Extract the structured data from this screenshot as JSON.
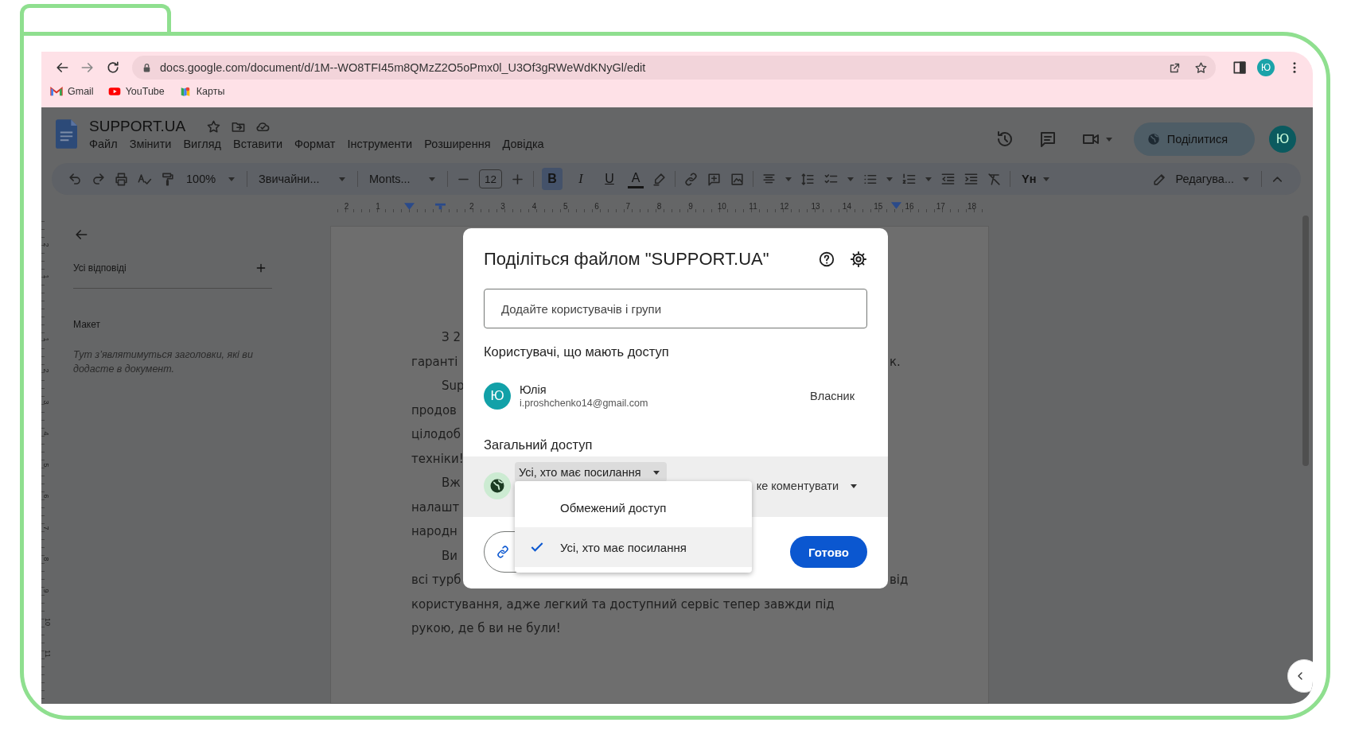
{
  "browser": {
    "url": "docs.google.com/document/d/1M--WO8TFI45m8QMzZ2O5oPmx0l_U3Of3gRWeWdKNyGl/edit",
    "profile_initial": "Ю",
    "bookmarks": [
      {
        "label": "Gmail",
        "kind": "gmail"
      },
      {
        "label": "YouTube",
        "kind": "youtube"
      },
      {
        "label": "Карты",
        "kind": "maps"
      }
    ]
  },
  "docs": {
    "title": "SUPPORT.UA",
    "menu": [
      "Файл",
      "Змінити",
      "Вигляд",
      "Вставити",
      "Формат",
      "Інструменти",
      "Розширення",
      "Довідка"
    ],
    "share_label": "Поділитися",
    "avatar_initial": "Ю",
    "toolbar": {
      "zoom": "100%",
      "style": "Звичайни...",
      "font": "Monts...",
      "font_size": "12",
      "text_color": "A",
      "input_tools": "Yн",
      "mode": "Редагува..."
    },
    "format_buttons": [
      {
        "label": "B",
        "selected": true
      },
      {
        "label": "I",
        "selected": false
      },
      {
        "label": "U",
        "selected": false
      }
    ],
    "ruler": [
      {
        "kind": "num",
        "label": "2"
      },
      {
        "kind": "num",
        "label": "1"
      },
      {
        "kind": "indent_marker"
      },
      {
        "kind": "tab_marker"
      },
      {
        "kind": "num",
        "label": "2"
      },
      {
        "kind": "num",
        "label": "3"
      },
      {
        "kind": "num",
        "label": "4"
      },
      {
        "kind": "num",
        "label": "5"
      },
      {
        "kind": "num",
        "label": "6"
      },
      {
        "kind": "num",
        "label": "7"
      },
      {
        "kind": "num",
        "label": "8"
      },
      {
        "kind": "num",
        "label": "9"
      },
      {
        "kind": "num",
        "label": "10"
      },
      {
        "kind": "num",
        "label": "11"
      },
      {
        "kind": "num",
        "label": "12"
      },
      {
        "kind": "num",
        "label": "13"
      },
      {
        "kind": "num",
        "label": "14"
      },
      {
        "kind": "num",
        "label": "15"
      },
      {
        "kind": "num",
        "label": "16"
      },
      {
        "kind": "num",
        "label": "17"
      },
      {
        "kind": "num",
        "label": "18"
      }
    ],
    "vertical_ruler": [
      "2",
      "1",
      "1",
      "2",
      "3",
      "4",
      "5",
      "6",
      "7",
      "8",
      "9",
      "10",
      "11"
    ],
    "outline": {
      "comments_label": "Усі відповіді",
      "section": "Макет",
      "hint": "Тут з’являтимуться заголовки, які ви додасте в документ."
    },
    "document_lines": [
      {
        "kind": "split",
        "indent": true,
        "left": "З 2"
      },
      {
        "kind": "split",
        "indent": false,
        "left": "гаранті",
        "right": "к."
      },
      {
        "kind": "split",
        "indent": true,
        "left": "Sup"
      },
      {
        "kind": "split",
        "indent": false,
        "left": "продов"
      },
      {
        "kind": "split",
        "indent": false,
        "left": "цілодоб"
      },
      {
        "kind": "split",
        "indent": false,
        "left": "техніки!"
      },
      {
        "kind": "split",
        "indent": true,
        "left": "Вж"
      },
      {
        "kind": "split",
        "indent": false,
        "left": "налашт"
      },
      {
        "kind": "split",
        "indent": false,
        "left": "народн"
      },
      {
        "kind": "split",
        "indent": true,
        "left": "Ви"
      },
      {
        "kind": "split",
        "indent": false,
        "left": "всі турб",
        "right": "від"
      },
      {
        "kind": "full",
        "text": "користування, адже легкий та доступний сервіс тепер завжди під"
      },
      {
        "kind": "full",
        "text": "рукою, де б ви не були!"
      }
    ]
  },
  "share_dialog": {
    "title": "Поділіться файлом \"SUPPORT.UA\"",
    "add_people": {
      "placeholder": "Додайте користувачів і групи"
    },
    "people_heading": "Користувачі, що мають доступ",
    "people": [
      {
        "initial": "Ю",
        "name": "Юлія",
        "email": "i.proshchenko14@gmail.com",
        "role": "Власник"
      }
    ],
    "general_heading": "Загальний доступ",
    "access_select": "Усі, хто має посилання",
    "role_select": "ке коментувати",
    "done_button": "Готово",
    "access_menu": [
      {
        "label": "Обмежений доступ",
        "selected": false
      },
      {
        "label": "Усі, хто має посилання",
        "selected": true
      }
    ]
  }
}
